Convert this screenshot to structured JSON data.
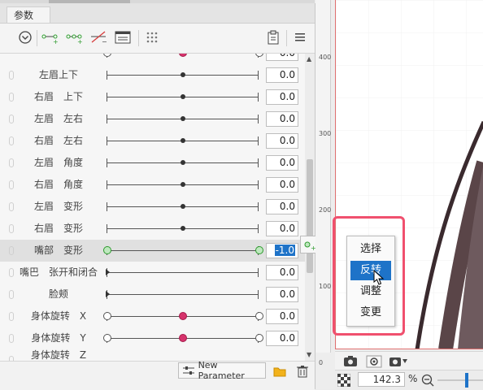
{
  "panel": {
    "tab_label": "参数",
    "toolbar_icons": [
      "chevron-circle-icon",
      "keys-two-icon",
      "keys-three-icon",
      "delete-keys-icon",
      "panel-view-icon",
      "grid-dots-icon",
      "clipboard-icon",
      "menu-icon"
    ]
  },
  "parameters": [
    {
      "label": "",
      "value": "0.0",
      "type": "partial"
    },
    {
      "label": "左眉上下",
      "value": "0.0",
      "type": "center"
    },
    {
      "label": "右眉　上下",
      "value": "0.0",
      "type": "center"
    },
    {
      "label": "左眉　左右",
      "value": "0.0",
      "type": "center"
    },
    {
      "label": "右眉　左右",
      "value": "0.0",
      "type": "center"
    },
    {
      "label": "左眉　角度",
      "value": "0.0",
      "type": "center"
    },
    {
      "label": "右眉　角度",
      "value": "0.0",
      "type": "center"
    },
    {
      "label": "左眉　变形",
      "value": "0.0",
      "type": "center"
    },
    {
      "label": "右眉　变形",
      "value": "0.0",
      "type": "center"
    },
    {
      "label": "嘴部　变形",
      "value": "-1.0",
      "type": "selected"
    },
    {
      "label": "嘴巴　张开和闭合",
      "value": "0.0",
      "type": "left"
    },
    {
      "label": "脸颊",
      "value": "0.0",
      "type": "left"
    },
    {
      "label": "身体旋转　X",
      "value": "0.0",
      "type": "keys"
    },
    {
      "label": "身体旋转　Y",
      "value": "0.0",
      "type": "keys"
    },
    {
      "label": "身体旋转　Z",
      "value": "",
      "type": "partial"
    }
  ],
  "bottom": {
    "new_parameter_label": "New Parameter"
  },
  "ruler": {
    "labels": [
      "400",
      "300",
      "200",
      "100",
      "0"
    ]
  },
  "context_menu": {
    "items": [
      "选择",
      "反转",
      "调整",
      "变更"
    ],
    "active_index": 1
  },
  "status": {
    "zoom_value": "142.3",
    "zoom_unit": "%"
  },
  "colors": {
    "accent": "#1e73c8",
    "highlight_box": "#f0506e",
    "key_dot": "#d6336c"
  }
}
